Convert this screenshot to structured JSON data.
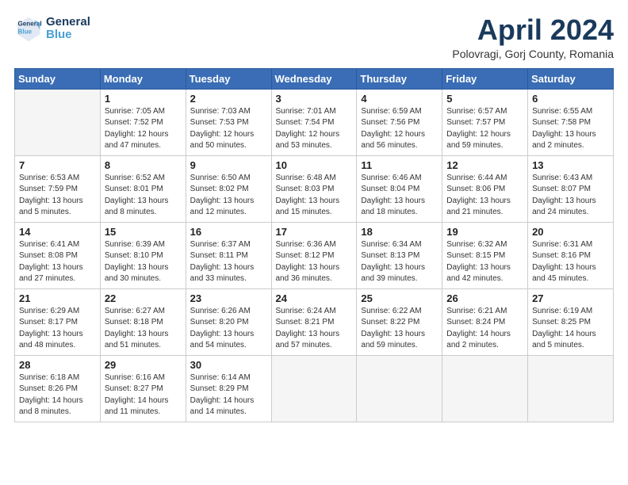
{
  "header": {
    "logo_line1": "General",
    "logo_line2": "Blue",
    "month": "April 2024",
    "location": "Polovragi, Gorj County, Romania"
  },
  "weekdays": [
    "Sunday",
    "Monday",
    "Tuesday",
    "Wednesday",
    "Thursday",
    "Friday",
    "Saturday"
  ],
  "weeks": [
    [
      {
        "day": "",
        "info": ""
      },
      {
        "day": "1",
        "info": "Sunrise: 7:05 AM\nSunset: 7:52 PM\nDaylight: 12 hours\nand 47 minutes."
      },
      {
        "day": "2",
        "info": "Sunrise: 7:03 AM\nSunset: 7:53 PM\nDaylight: 12 hours\nand 50 minutes."
      },
      {
        "day": "3",
        "info": "Sunrise: 7:01 AM\nSunset: 7:54 PM\nDaylight: 12 hours\nand 53 minutes."
      },
      {
        "day": "4",
        "info": "Sunrise: 6:59 AM\nSunset: 7:56 PM\nDaylight: 12 hours\nand 56 minutes."
      },
      {
        "day": "5",
        "info": "Sunrise: 6:57 AM\nSunset: 7:57 PM\nDaylight: 12 hours\nand 59 minutes."
      },
      {
        "day": "6",
        "info": "Sunrise: 6:55 AM\nSunset: 7:58 PM\nDaylight: 13 hours\nand 2 minutes."
      }
    ],
    [
      {
        "day": "7",
        "info": "Sunrise: 6:53 AM\nSunset: 7:59 PM\nDaylight: 13 hours\nand 5 minutes."
      },
      {
        "day": "8",
        "info": "Sunrise: 6:52 AM\nSunset: 8:01 PM\nDaylight: 13 hours\nand 8 minutes."
      },
      {
        "day": "9",
        "info": "Sunrise: 6:50 AM\nSunset: 8:02 PM\nDaylight: 13 hours\nand 12 minutes."
      },
      {
        "day": "10",
        "info": "Sunrise: 6:48 AM\nSunset: 8:03 PM\nDaylight: 13 hours\nand 15 minutes."
      },
      {
        "day": "11",
        "info": "Sunrise: 6:46 AM\nSunset: 8:04 PM\nDaylight: 13 hours\nand 18 minutes."
      },
      {
        "day": "12",
        "info": "Sunrise: 6:44 AM\nSunset: 8:06 PM\nDaylight: 13 hours\nand 21 minutes."
      },
      {
        "day": "13",
        "info": "Sunrise: 6:43 AM\nSunset: 8:07 PM\nDaylight: 13 hours\nand 24 minutes."
      }
    ],
    [
      {
        "day": "14",
        "info": "Sunrise: 6:41 AM\nSunset: 8:08 PM\nDaylight: 13 hours\nand 27 minutes."
      },
      {
        "day": "15",
        "info": "Sunrise: 6:39 AM\nSunset: 8:10 PM\nDaylight: 13 hours\nand 30 minutes."
      },
      {
        "day": "16",
        "info": "Sunrise: 6:37 AM\nSunset: 8:11 PM\nDaylight: 13 hours\nand 33 minutes."
      },
      {
        "day": "17",
        "info": "Sunrise: 6:36 AM\nSunset: 8:12 PM\nDaylight: 13 hours\nand 36 minutes."
      },
      {
        "day": "18",
        "info": "Sunrise: 6:34 AM\nSunset: 8:13 PM\nDaylight: 13 hours\nand 39 minutes."
      },
      {
        "day": "19",
        "info": "Sunrise: 6:32 AM\nSunset: 8:15 PM\nDaylight: 13 hours\nand 42 minutes."
      },
      {
        "day": "20",
        "info": "Sunrise: 6:31 AM\nSunset: 8:16 PM\nDaylight: 13 hours\nand 45 minutes."
      }
    ],
    [
      {
        "day": "21",
        "info": "Sunrise: 6:29 AM\nSunset: 8:17 PM\nDaylight: 13 hours\nand 48 minutes."
      },
      {
        "day": "22",
        "info": "Sunrise: 6:27 AM\nSunset: 8:18 PM\nDaylight: 13 hours\nand 51 minutes."
      },
      {
        "day": "23",
        "info": "Sunrise: 6:26 AM\nSunset: 8:20 PM\nDaylight: 13 hours\nand 54 minutes."
      },
      {
        "day": "24",
        "info": "Sunrise: 6:24 AM\nSunset: 8:21 PM\nDaylight: 13 hours\nand 57 minutes."
      },
      {
        "day": "25",
        "info": "Sunrise: 6:22 AM\nSunset: 8:22 PM\nDaylight: 13 hours\nand 59 minutes."
      },
      {
        "day": "26",
        "info": "Sunrise: 6:21 AM\nSunset: 8:24 PM\nDaylight: 14 hours\nand 2 minutes."
      },
      {
        "day": "27",
        "info": "Sunrise: 6:19 AM\nSunset: 8:25 PM\nDaylight: 14 hours\nand 5 minutes."
      }
    ],
    [
      {
        "day": "28",
        "info": "Sunrise: 6:18 AM\nSunset: 8:26 PM\nDaylight: 14 hours\nand 8 minutes."
      },
      {
        "day": "29",
        "info": "Sunrise: 6:16 AM\nSunset: 8:27 PM\nDaylight: 14 hours\nand 11 minutes."
      },
      {
        "day": "30",
        "info": "Sunrise: 6:14 AM\nSunset: 8:29 PM\nDaylight: 14 hours\nand 14 minutes."
      },
      {
        "day": "",
        "info": ""
      },
      {
        "day": "",
        "info": ""
      },
      {
        "day": "",
        "info": ""
      },
      {
        "day": "",
        "info": ""
      }
    ]
  ]
}
